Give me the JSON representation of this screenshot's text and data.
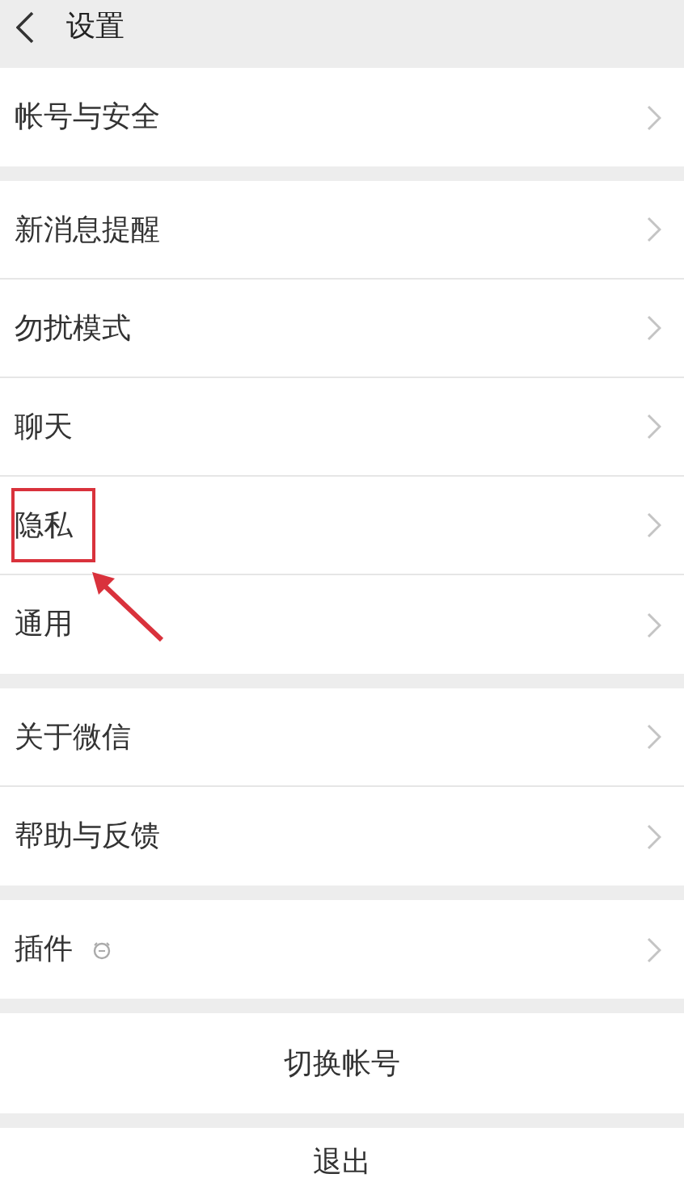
{
  "header": {
    "title": "设置"
  },
  "groups": [
    {
      "kind": "list",
      "items": [
        {
          "label": "帐号与安全",
          "highlighted": false,
          "has_icon": false
        }
      ]
    },
    {
      "kind": "list",
      "items": [
        {
          "label": "新消息提醒",
          "highlighted": false,
          "has_icon": false
        },
        {
          "label": "勿扰模式",
          "highlighted": false,
          "has_icon": false
        },
        {
          "label": "聊天",
          "highlighted": false,
          "has_icon": false
        },
        {
          "label": "隐私",
          "highlighted": true,
          "has_icon": false
        },
        {
          "label": "通用",
          "highlighted": false,
          "has_icon": false
        }
      ]
    },
    {
      "kind": "list",
      "items": [
        {
          "label": "关于微信",
          "highlighted": false,
          "has_icon": false
        },
        {
          "label": "帮助与反馈",
          "highlighted": false,
          "has_icon": false
        }
      ]
    },
    {
      "kind": "list",
      "items": [
        {
          "label": "插件",
          "highlighted": false,
          "has_icon": true
        }
      ]
    },
    {
      "kind": "button",
      "label": "切换帐号"
    },
    {
      "kind": "button",
      "label": "退出"
    }
  ]
}
